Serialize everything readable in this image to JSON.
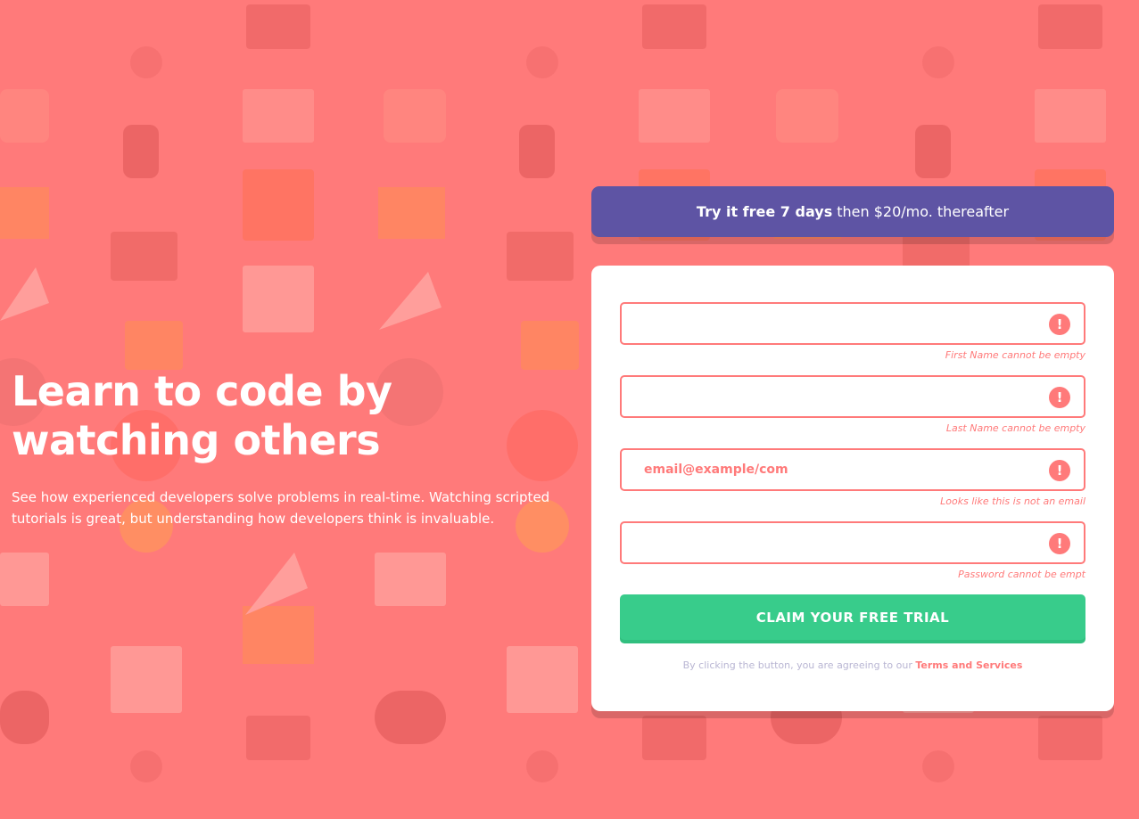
{
  "hero": {
    "title_line1": "Learn to code by",
    "title_line2": "watching others",
    "description": "See how experienced developers solve problems in real-time. Watching scripted tutorials is great, but understanding how developers think is invaluable."
  },
  "promo": {
    "strong_text": "Try it free 7 days",
    "rest_text": "then $20/mo. thereafter"
  },
  "form": {
    "fields": [
      {
        "name": "first-name",
        "value": "",
        "placeholder": "",
        "error": "First Name cannot be empty",
        "icon": "!"
      },
      {
        "name": "last-name",
        "value": "",
        "placeholder": "",
        "error": "Last Name cannot be empty",
        "icon": "!"
      },
      {
        "name": "email",
        "value": "",
        "placeholder": "email@example/com",
        "error": "Looks like this is not an email",
        "icon": "!"
      },
      {
        "name": "password",
        "value": "",
        "placeholder": "",
        "error": "Password cannot be empt",
        "icon": "!"
      }
    ],
    "submit_label": "CLAIM YOUR FREE TRIAL",
    "terms_prefix": "By clicking the button, you are agreeing to our",
    "terms_link": "Terms and Services"
  },
  "colors": {
    "background": "#ff7a7a",
    "promo": "#5e54a4",
    "cta": "#38cc8b",
    "error": "#ff7a7a",
    "muted": "#b9b6d3"
  }
}
